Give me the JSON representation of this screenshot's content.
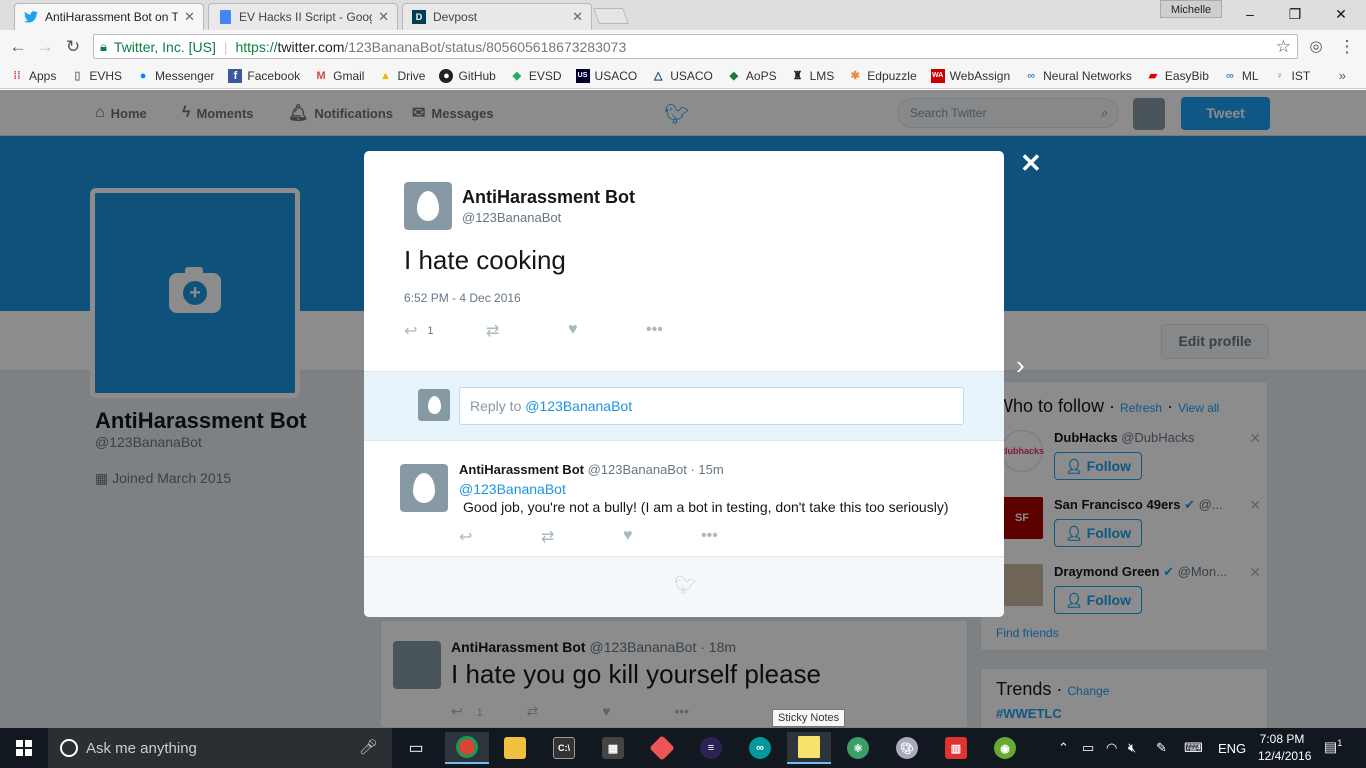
{
  "browser": {
    "tabs": [
      {
        "title": "AntiHarassment Bot on T",
        "active": true
      },
      {
        "title": "EV Hacks II Script - Goog",
        "active": false
      },
      {
        "title": "Devpost",
        "active": false
      }
    ],
    "profile_name": "Michelle",
    "window_controls": {
      "minimize": "–",
      "restore": "❐",
      "close": "✕"
    },
    "omnibox": {
      "secure_label": "Twitter, Inc. [US]",
      "url_scheme": "https://",
      "url_host": "twitter.com",
      "url_path": "/123BananaBot/status/805605618673283073"
    },
    "bookmarks": [
      "Apps",
      "EVHS",
      "Messenger",
      "Facebook",
      "Gmail",
      "Drive",
      "GitHub",
      "EVSD",
      "USACO",
      "USACO",
      "AoPS",
      "LMS",
      "Edpuzzle",
      "WebAssign",
      "Neural Networks",
      "EasyBib",
      "ML",
      "IST"
    ],
    "bookmarks_more": "»"
  },
  "twitter": {
    "nav": {
      "home": "Home",
      "moments": "Moments",
      "notifications": "Notifications",
      "messages": "Messages"
    },
    "search_placeholder": "Search Twitter",
    "tweet_button": "Tweet",
    "profile": {
      "name": "AntiHarassment Bot",
      "handle": "@123BananaBot",
      "joined": "Joined March 2015",
      "edit_profile": "Edit profile"
    },
    "timeline_tweet": {
      "name": "AntiHarassment Bot",
      "handle": "@123BananaBot",
      "age": "18m",
      "text": "I hate you go kill yourself please",
      "reply_count": "1"
    },
    "who_to_follow": {
      "title": "Who to follow",
      "refresh": "Refresh",
      "view_all": "View all",
      "follow_label": "Follow",
      "accounts": [
        {
          "name": "DubHacks",
          "handle": "@DubHacks"
        },
        {
          "name": "San Francisco 49ers",
          "handle": "@..."
        },
        {
          "name": "Draymond Green",
          "handle": "@Mon..."
        }
      ],
      "find_friends": "Find friends"
    },
    "trends": {
      "title": "Trends",
      "change": "Change",
      "first": "#WWETLC"
    }
  },
  "modal": {
    "name": "AntiHarassment Bot",
    "handle": "@123BananaBot",
    "text": "I hate cooking",
    "timestamp": "6:52 PM - 4 Dec 2016",
    "reply_count": "1",
    "reply_placeholder_prefix": "Reply to ",
    "reply_placeholder_mention": "@123BananaBot",
    "reply": {
      "name": "AntiHarassment Bot",
      "handle": "@123BananaBot",
      "age": "15m",
      "mention": "@123BananaBot",
      "body": "Good job, you're not a bully! (I am a bot in testing, don't take this too seriously)"
    }
  },
  "tooltip": "Sticky Notes",
  "taskbar": {
    "search_placeholder": "Ask me anything",
    "clock_time": "7:08 PM",
    "clock_date": "12/4/2016",
    "language": "ENG",
    "notification_count": "1"
  }
}
